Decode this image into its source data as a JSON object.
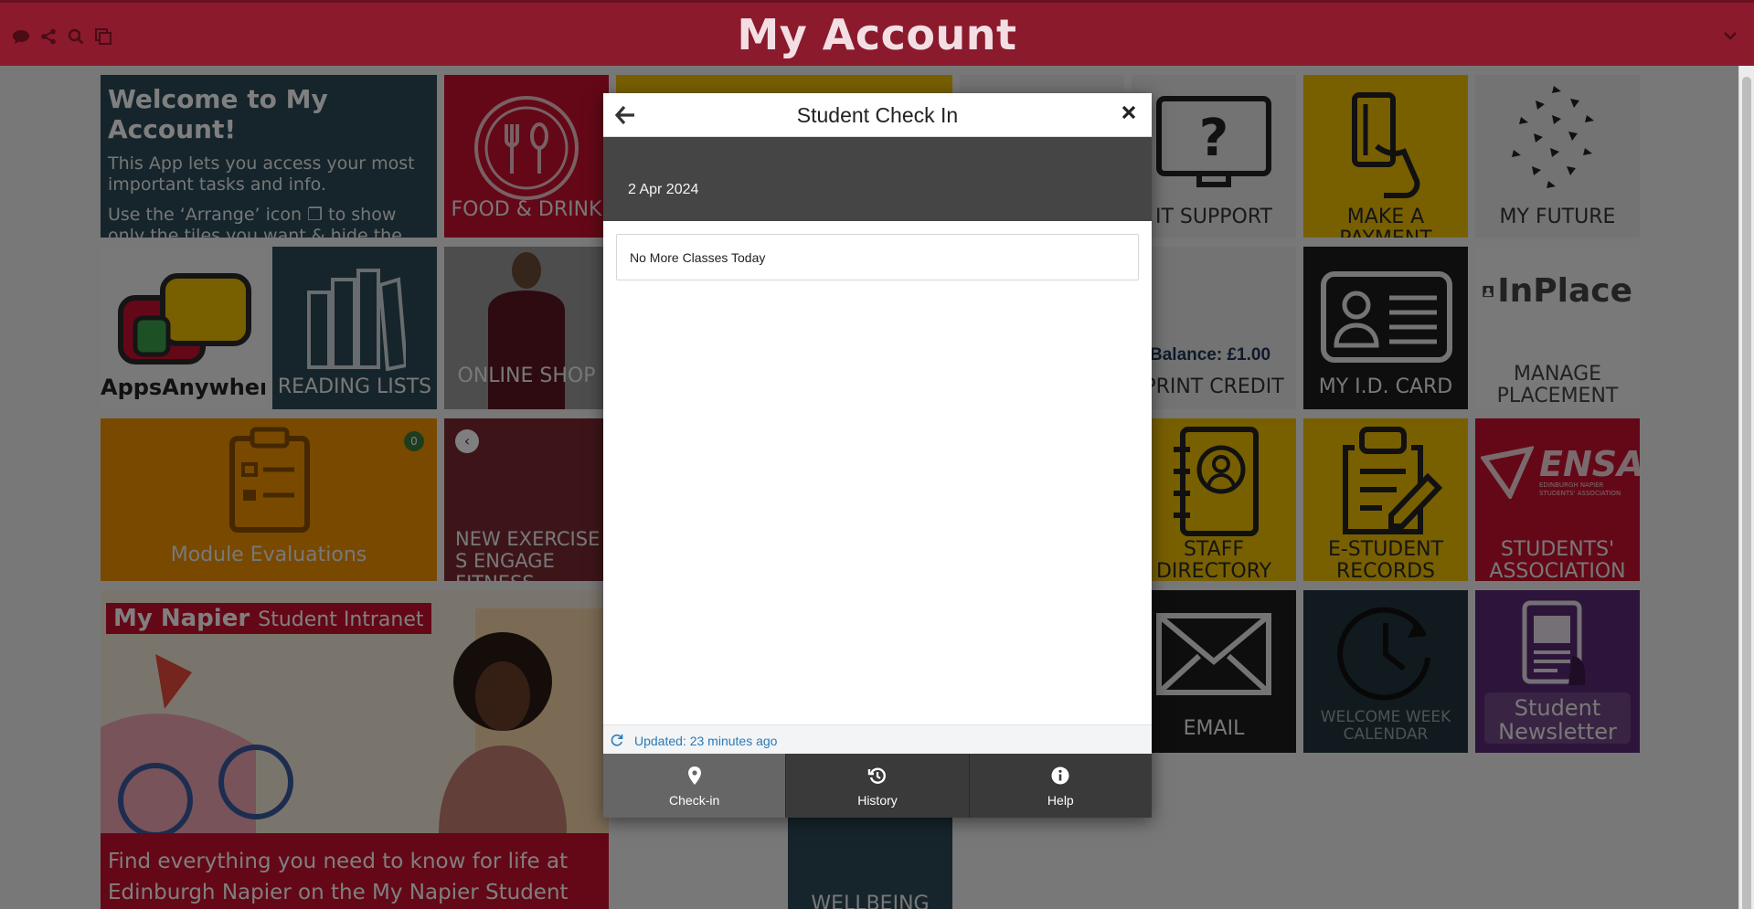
{
  "header": {
    "title": "My Account",
    "icons": [
      "chat-icon",
      "share-icon",
      "search-icon",
      "arrange-icon"
    ],
    "menu_icon": "chevron-down-icon"
  },
  "tiles": {
    "welcome": {
      "heading": "Welcome to My Account!",
      "line1": "This App lets you access your most important tasks and info.",
      "line2": "Use the ‘Arrange’ icon",
      "line3": "to show only the tiles you want & hide the rest."
    },
    "food_drink": "FOOD & DRINK",
    "it_support": "IT SUPPORT",
    "make_payment": "MAKE A PAYMENT",
    "my_future": "MY FUTURE",
    "apps_anywhere": "AppsAnywhere",
    "reading_lists": "READING LISTS",
    "online_shop": "ONLINE SHOP",
    "print_balance": "Balance: £1.00",
    "print_credit": "PRINT CREDIT",
    "id_card": "MY I.D. CARD",
    "inplace_logo": "InPlace",
    "manage_placement": "MANAGE PLACEMENT",
    "module_evaluations": "Module Evaluations",
    "module_badge": "0",
    "exercise": "NEW EXERCISE S ENGAGE FITNESS",
    "staff_directory": "STAFF DIRECTORY",
    "e_student": "E-STUDENT RECORDS",
    "ensa_logo": "ENSA",
    "ensa_sub": "EDINBURGH NAPIER STUDENTS' ASSOCIATION",
    "students_assoc": "STUDENTS' ASSOCIATION",
    "my_napier_brand": "My Napier",
    "my_napier_sub": "Student Intranet",
    "my_napier_text": "Find everything you need to know for life at Edinburgh Napier on the My Napier Student Intranet",
    "email": "EMAIL",
    "welcome_week": "WELCOME WEEK CALENDAR",
    "newsletter": "Student Newsletter",
    "wellbeing": "WELLBEING"
  },
  "modal": {
    "title": "Student Check In",
    "date": "2 Apr 2024",
    "message": "No More Classes Today",
    "status": "Updated: 23 minutes ago",
    "tabs": [
      {
        "label": "Check-in",
        "icon": "location-pin-icon"
      },
      {
        "label": "History",
        "icon": "history-icon"
      },
      {
        "label": "Help",
        "icon": "info-icon"
      }
    ]
  }
}
